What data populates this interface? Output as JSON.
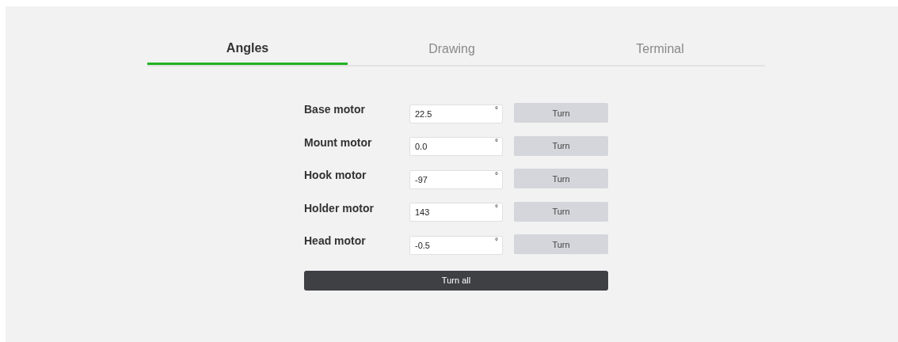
{
  "tabs": [
    {
      "label": "Angles",
      "selected": true
    },
    {
      "label": "Drawing",
      "selected": false
    },
    {
      "label": "Terminal",
      "selected": false
    }
  ],
  "motors": [
    {
      "name": "Base motor",
      "value": "22.5",
      "unit": "°",
      "button": "Turn"
    },
    {
      "name": "Mount motor",
      "value": "0.0",
      "unit": "°",
      "button": "Turn"
    },
    {
      "name": "Hook motor",
      "value": "-97",
      "unit": "°",
      "button": "Turn"
    },
    {
      "name": "Holder motor",
      "value": "143",
      "unit": "°",
      "button": "Turn"
    },
    {
      "name": "Head motor",
      "value": "-0.5",
      "unit": "°",
      "button": "Turn"
    }
  ],
  "turn_all_button": "Turn all"
}
